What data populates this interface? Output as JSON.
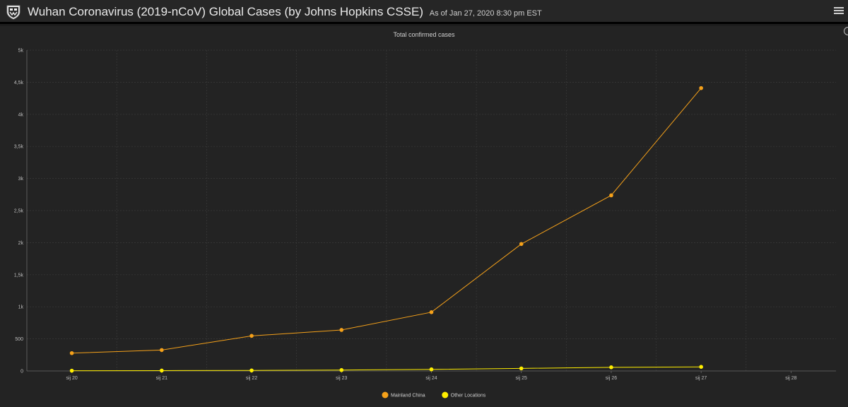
{
  "header": {
    "title": "Wuhan Coronavirus (2019-nCoV) Global Cases (by Johns Hopkins CSSE)",
    "subtitle": "As of Jan 27, 2020 8:30 pm EST",
    "logo_icon": "university-shield-icon",
    "menu_icon": "hamburger-menu-icon"
  },
  "chart_data": {
    "type": "line",
    "title": "Total confirmed cases",
    "categories": [
      "sij 20",
      "sij 21",
      "sij 22",
      "sij 23",
      "sij 24",
      "sij 25",
      "sij 26",
      "sij 27",
      "sij 28"
    ],
    "y_ticks": [
      "0",
      "500",
      "1k",
      "1,5k",
      "2k",
      "2,5k",
      "3k",
      "3,5k",
      "4k",
      "4,5k",
      "5k"
    ],
    "ylim": [
      0,
      5000
    ],
    "grid": true,
    "legend_position": "bottom-center",
    "series": [
      {
        "name": "Mainland China",
        "color": "#f5a11a",
        "values": [
          278,
          326,
          547,
          639,
          916,
          1979,
          2737,
          4409
        ]
      },
      {
        "name": "Other Locations",
        "color": "#ffee00",
        "values": [
          4,
          6,
          8,
          14,
          25,
          40,
          57,
          64
        ]
      }
    ]
  }
}
